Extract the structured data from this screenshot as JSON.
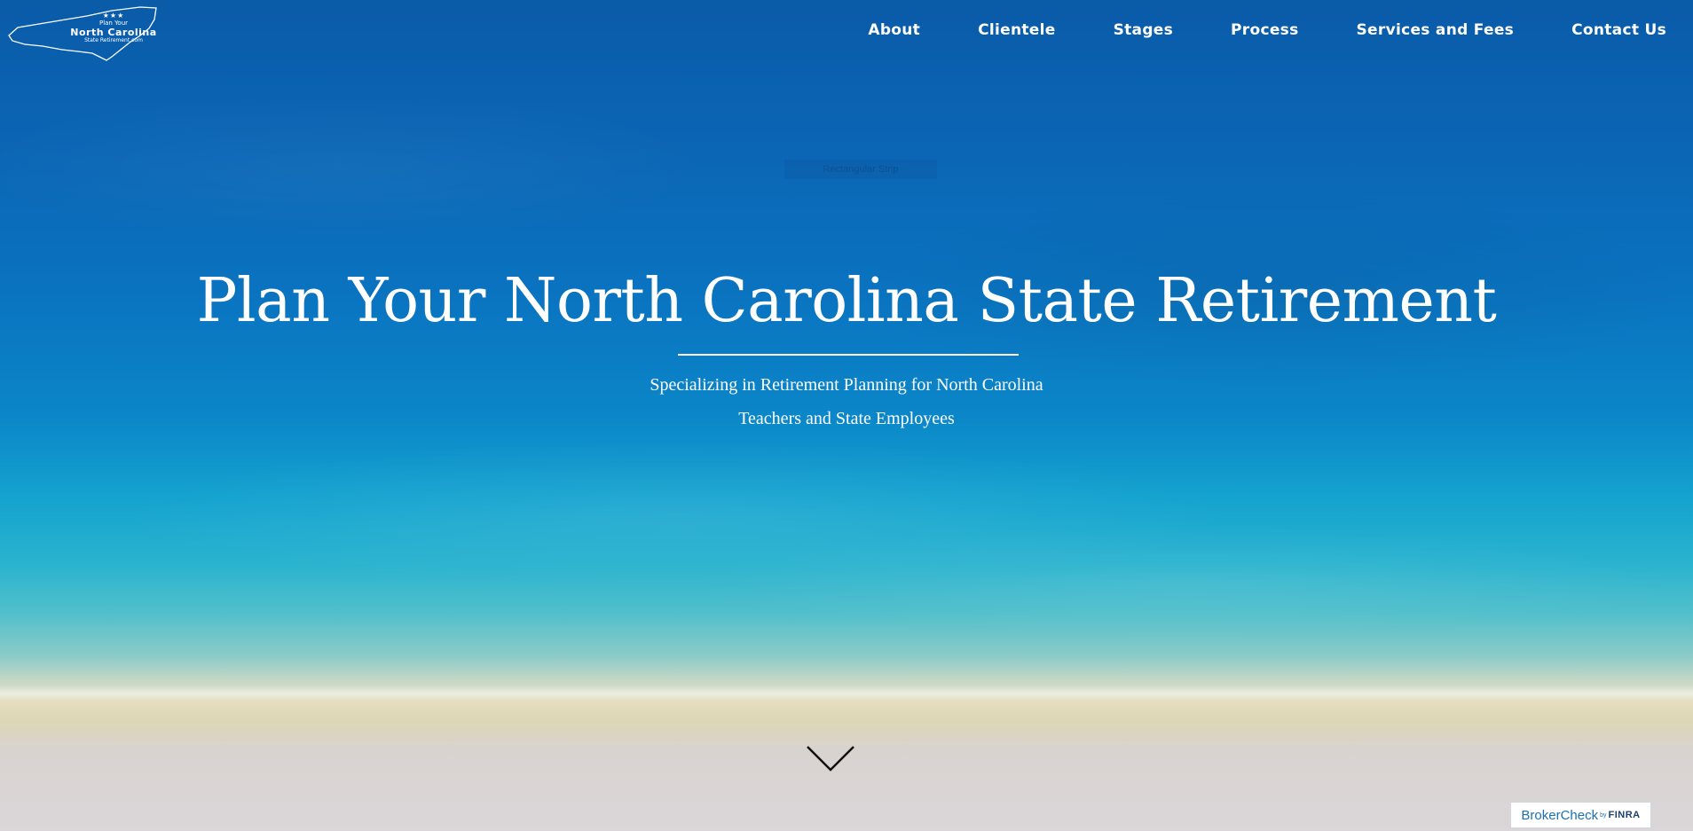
{
  "logo": {
    "line1": "Plan Your",
    "line2": "North Carolina",
    "line3": "State Retirement.com",
    "stars": "★★★"
  },
  "nav": {
    "items": [
      {
        "label": "About"
      },
      {
        "label": "Clientele"
      },
      {
        "label": "Stages"
      },
      {
        "label": "Process"
      },
      {
        "label": "Services and Fees"
      },
      {
        "label": "Contact Us"
      }
    ]
  },
  "ghost_text": "Rectangular Strip",
  "hero": {
    "title": "Plan Your North Carolina State Retirement",
    "subtitle_line1": "Specializing in Retirement Planning for North Carolina",
    "subtitle_line2": "Teachers and State Employees"
  },
  "scroll_icon": "chevron-down-icon",
  "badge": {
    "main": "BrokerCheck",
    "by": "by",
    "org": "FINRA"
  },
  "colors": {
    "text": "#ffffff",
    "badge_blue": "#1d6fb1",
    "badge_navy": "#1d3f6e"
  }
}
